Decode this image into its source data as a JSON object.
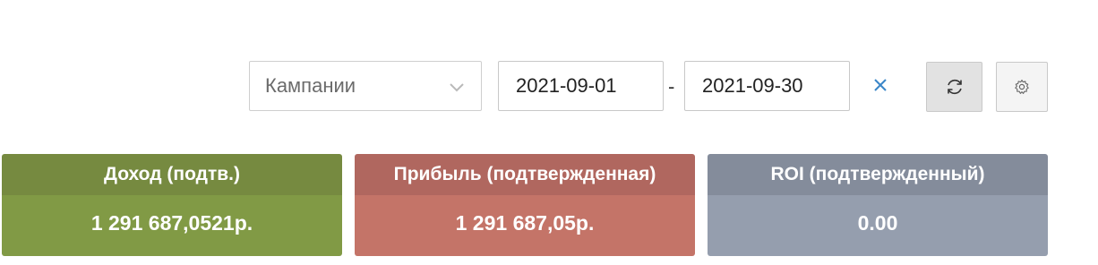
{
  "filters": {
    "campaign_select": {
      "placeholder": "Кампании",
      "icon": "chevron-down-icon"
    },
    "date_from": "2021-09-01",
    "date_separator": "-",
    "date_to": "2021-09-30",
    "clear_icon": "close-icon",
    "refresh_icon": "refresh-icon",
    "settings_icon": "gear-icon"
  },
  "cards": {
    "income": {
      "title": "Доход (подтв.)",
      "value": "1 291 687,0521р.",
      "color": "#819a45"
    },
    "profit": {
      "title": "Прибыль (подтвержденная)",
      "value": "1 291 687,05р.",
      "color": "#c47468"
    },
    "roi": {
      "title": "ROI (подтвержденный)",
      "value": "0.00",
      "color": "#959eae"
    }
  },
  "colors": {
    "accent_blue": "#3a86c8"
  }
}
